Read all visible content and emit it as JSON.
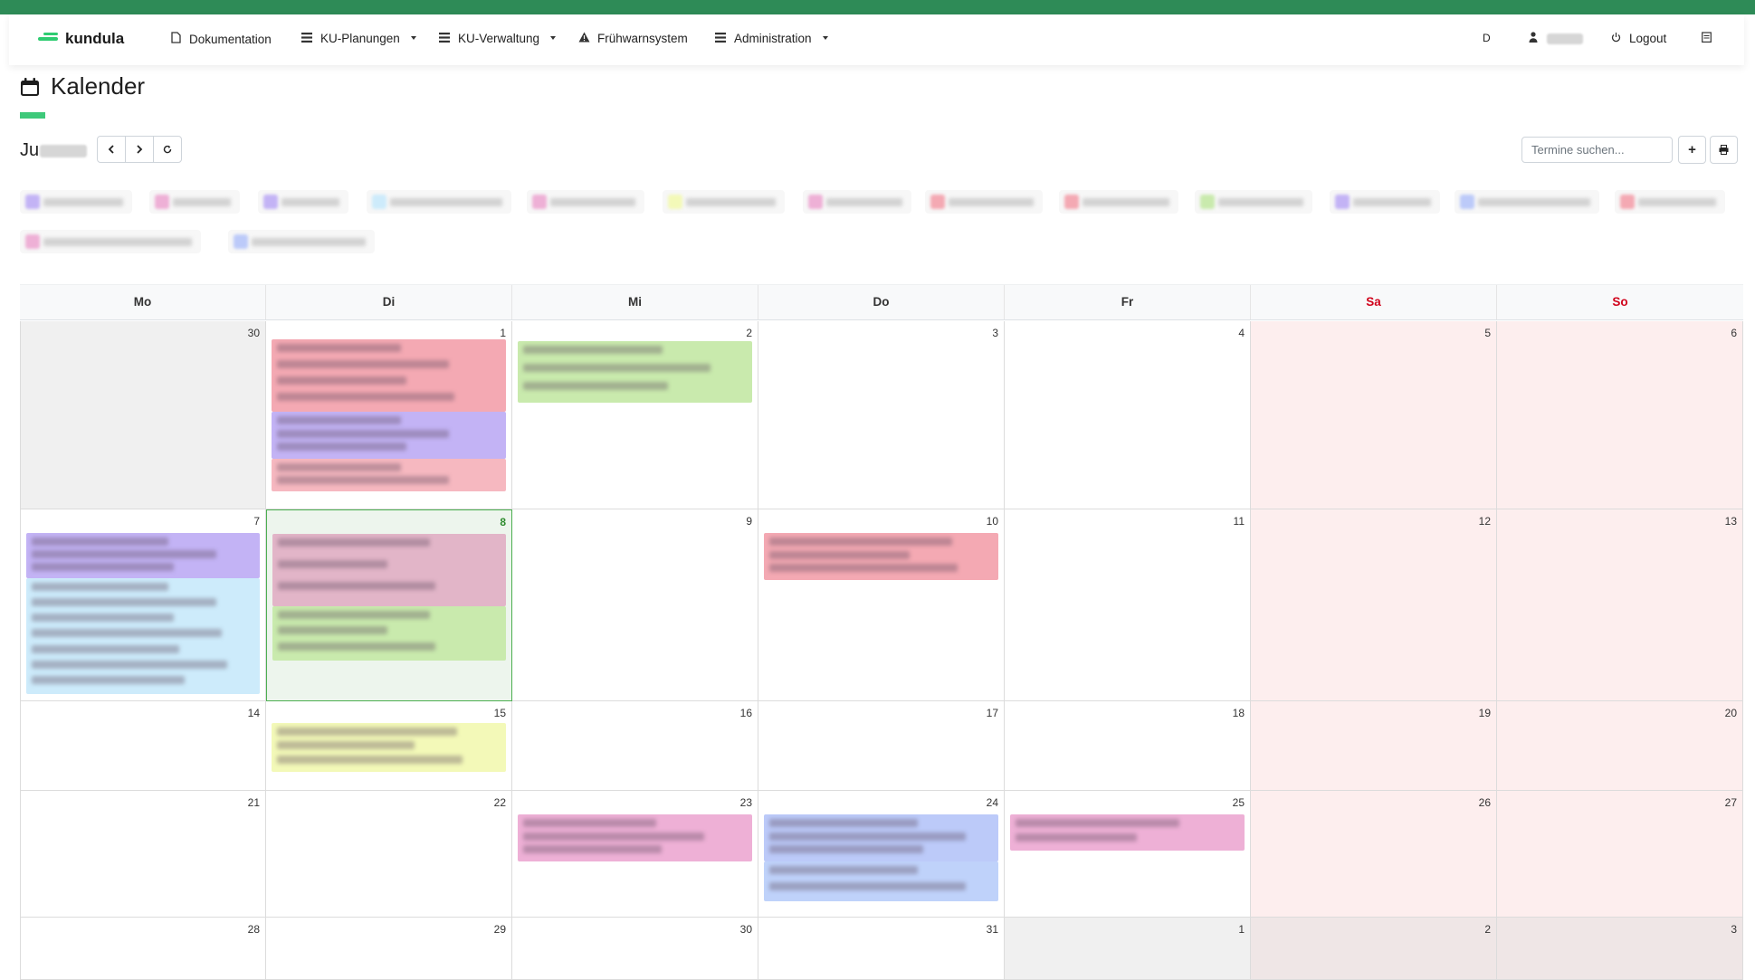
{
  "app": {
    "brand": "kundula"
  },
  "nav": {
    "items": [
      {
        "label": "Dokumentation",
        "icon": "document-icon",
        "dropdown": false
      },
      {
        "label": "KU-Planungen",
        "icon": "menu-icon",
        "dropdown": true
      },
      {
        "label": "KU-Verwaltung",
        "icon": "menu-icon",
        "dropdown": true
      },
      {
        "label": "Frühwarnsystem",
        "icon": "warning-icon",
        "dropdown": false
      },
      {
        "label": "Administration",
        "icon": "menu-icon",
        "dropdown": true
      }
    ],
    "theme_toggle": "D",
    "logout_label": "Logout"
  },
  "page": {
    "title": "Kalender",
    "month_label": "Ju"
  },
  "toolbar": {
    "search_placeholder": "Termine suchen...",
    "add_label": "+"
  },
  "weekdays": [
    "Mo",
    "Di",
    "Mi",
    "Do",
    "Fr",
    "Sa",
    "So"
  ],
  "weeks": [
    [
      "30",
      "1",
      "2",
      "3",
      "4",
      "5",
      "6"
    ],
    [
      "7",
      "8",
      "9",
      "10",
      "11",
      "12",
      "13"
    ],
    [
      "14",
      "15",
      "16",
      "17",
      "18",
      "19",
      "20"
    ],
    [
      "21",
      "22",
      "23",
      "24",
      "25",
      "26",
      "27"
    ],
    [
      "28",
      "29",
      "30",
      "31",
      "1",
      "2",
      "3"
    ]
  ],
  "colors": {
    "brand_green": "#2e8b57",
    "accent_green": "#3ec97a",
    "weekend_red": "#d0021b",
    "event_red": "#f4a9b3",
    "event_purple": "#c3b3f5",
    "event_green": "#c9eaad",
    "event_blue": "#cdebfb",
    "event_yellow": "#f3f9b8",
    "event_pink": "#eeb0d6",
    "event_periwinkle": "#bccaf9"
  }
}
